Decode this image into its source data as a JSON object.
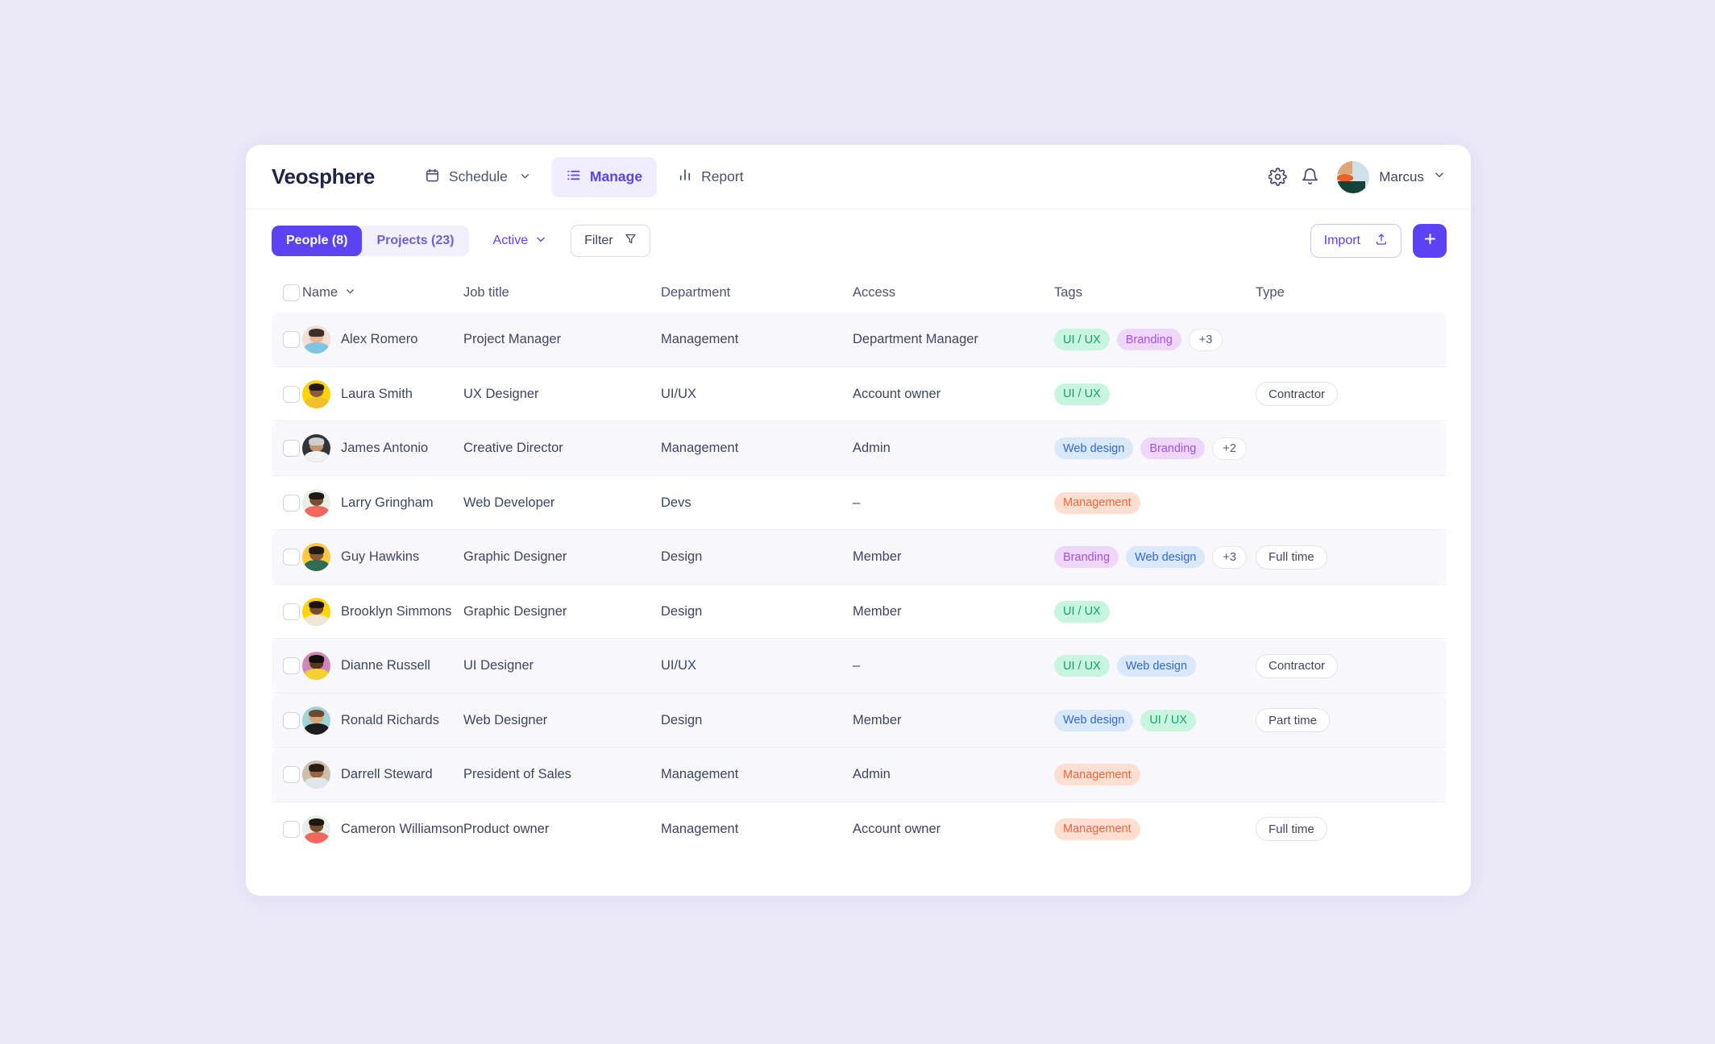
{
  "app": {
    "brand": "Veosphere",
    "nav": [
      {
        "label": "Schedule",
        "icon": "calendar-icon",
        "active": false,
        "caret": true
      },
      {
        "label": "Manage",
        "icon": "list-icon",
        "active": true,
        "caret": false
      },
      {
        "label": "Report",
        "icon": "bar-chart-icon",
        "active": false,
        "caret": false
      }
    ],
    "settings_icon": "gear-icon",
    "notifications_icon": "bell-icon",
    "profile": {
      "name": "Marcus",
      "avatar": "user-avatar",
      "caret_icon": "chevron-down-icon"
    }
  },
  "toolbar": {
    "segments": [
      {
        "label": "People (8)",
        "active": true
      },
      {
        "label": "Projects (23)",
        "active": false
      }
    ],
    "status_filter": {
      "label": "Active",
      "icon": "chevron-down-icon"
    },
    "filter": {
      "label": "Filter",
      "icon": "funnel-icon"
    },
    "import": {
      "label": "Import",
      "icon": "upload-icon"
    },
    "add": {
      "label": "+",
      "icon": "plus-icon"
    }
  },
  "table": {
    "columns": [
      "Name",
      "Job title",
      "Department",
      "Access",
      "Tags",
      "Type"
    ],
    "sort_icon": "chevron-down-icon",
    "select_all": false,
    "rows": [
      {
        "name": "Alex Romero",
        "job": "Project Manager",
        "dept": "Management",
        "access": "Department Manager",
        "tags": [
          {
            "label": "UI / UX",
            "style": "uiux"
          },
          {
            "label": "Branding",
            "style": "brand"
          }
        ],
        "more": "+3",
        "type": "",
        "zebra": true,
        "avatar": {
          "bg": "#f3ded8",
          "skin": "#e8b79a",
          "hair": "#3c2f2a",
          "shirt": "#7fc5e0"
        }
      },
      {
        "name": "Laura Smith",
        "job": "UX Designer",
        "dept": "UI/UX",
        "access": "Account owner",
        "tags": [
          {
            "label": "UI / UX",
            "style": "uiux"
          }
        ],
        "more": "",
        "type": "Contractor",
        "zebra": false,
        "avatar": {
          "bg": "#ffd500",
          "skin": "#8b5a3c",
          "hair": "#231a16",
          "shirt": "#f2c02a"
        }
      },
      {
        "name": "James Antonio",
        "job": "Creative Director",
        "dept": "Management",
        "access": "Admin",
        "tags": [
          {
            "label": "Web design",
            "style": "web"
          },
          {
            "label": "Branding",
            "style": "brand"
          }
        ],
        "more": "+2",
        "type": "",
        "zebra": true,
        "avatar": {
          "bg": "#2f3437",
          "skin": "#c89272",
          "hair": "#cfcfcf",
          "shirt": "#f2f2f2"
        }
      },
      {
        "name": "Larry Gringham",
        "job": "Web Developer",
        "dept": "Devs",
        "access": "–",
        "tags": [
          {
            "label": "Management",
            "style": "mgmt"
          }
        ],
        "more": "",
        "type": "",
        "zebra": false,
        "avatar": {
          "bg": "#e7efe6",
          "skin": "#7a4c2e",
          "hair": "#201713",
          "shirt": "#f2685e"
        }
      },
      {
        "name": "Guy Hawkins",
        "job": "Graphic Designer",
        "dept": "Design",
        "access": "Member",
        "tags": [
          {
            "label": "Branding",
            "style": "brand"
          },
          {
            "label": "Web design",
            "style": "web"
          }
        ],
        "more": "+3",
        "type": "Full time",
        "zebra": true,
        "avatar": {
          "bg": "#ffc93c",
          "skin": "#8a5a34",
          "hair": "#241a14",
          "shirt": "#2f6b55"
        }
      },
      {
        "name": "Brooklyn Simmons",
        "job": "Graphic Designer",
        "dept": "Design",
        "access": "Member",
        "tags": [
          {
            "label": "UI / UX",
            "style": "uiux"
          }
        ],
        "more": "",
        "type": "",
        "zebra": false,
        "avatar": {
          "bg": "#ffd400",
          "skin": "#7a4a2c",
          "hair": "#1d1411",
          "shirt": "#f0e6da"
        }
      },
      {
        "name": "Dianne Russell",
        "job": "UI Designer",
        "dept": "UI/UX",
        "access": "–",
        "tags": [
          {
            "label": "UI / UX",
            "style": "uiux"
          },
          {
            "label": "Web design",
            "style": "web"
          }
        ],
        "more": "",
        "type": "Contractor",
        "zebra": true,
        "avatar": {
          "bg": "#cf86b8",
          "skin": "#5c3520",
          "hair": "#140e0c",
          "shirt": "#f2d22e"
        }
      },
      {
        "name": "Ronald Richards",
        "job": "Web Designer",
        "dept": "Design",
        "access": "Member",
        "tags": [
          {
            "label": "Web design",
            "style": "web"
          },
          {
            "label": "UI / UX",
            "style": "uiux"
          }
        ],
        "more": "",
        "type": "Part time",
        "zebra": true,
        "avatar": {
          "bg": "#9fd3d8",
          "skin": "#d9a277",
          "hair": "#6b4a2e",
          "shirt": "#1d1d1d"
        }
      },
      {
        "name": "Darrell Steward",
        "job": "President of Sales",
        "dept": "Management",
        "access": "Admin",
        "tags": [
          {
            "label": "Management",
            "style": "mgmt"
          }
        ],
        "more": "",
        "type": "",
        "zebra": true,
        "avatar": {
          "bg": "#cdbfae",
          "skin": "#9a6440",
          "hair": "#2b1d15",
          "shirt": "#dfe6ec"
        }
      },
      {
        "name": "Cameron Williamson",
        "job": "Product owner",
        "dept": "Management",
        "access": "Account owner",
        "tags": [
          {
            "label": "Management",
            "style": "mgmt"
          }
        ],
        "more": "",
        "type": "Full time",
        "zebra": false,
        "avatar": {
          "bg": "#e7efe6",
          "skin": "#7a4c2e",
          "hair": "#201713",
          "shirt": "#f2685e"
        }
      }
    ]
  },
  "colors": {
    "accent": "#5b42f3",
    "page_bg": "#ebe9f8",
    "zebra": "#f8f8fc",
    "tag_uiux_bg": "#c8f5dd",
    "tag_uiux_fg": "#16a06a",
    "tag_branding_bg": "#eed7fb",
    "tag_branding_fg": "#a54ef0",
    "tag_web_bg": "#d9e8fd",
    "tag_web_fg": "#2f68d8",
    "tag_mgmt_bg": "#ffdfd2",
    "tag_mgmt_fg": "#f4643c"
  }
}
